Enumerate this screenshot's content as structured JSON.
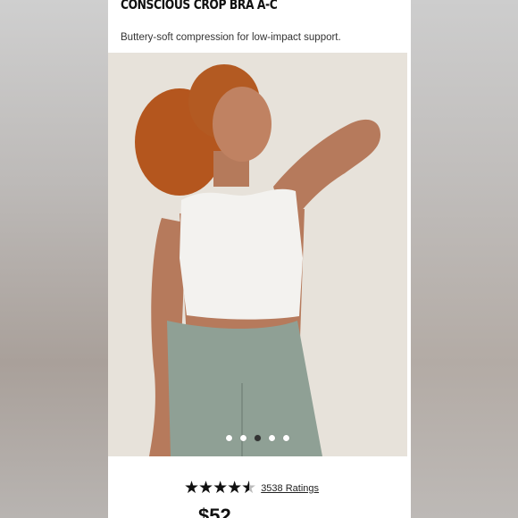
{
  "product": {
    "title": "CONSCIOUS CROP BRA A-C",
    "description": "Buttery-soft compression for low-impact support.",
    "rating_count_label": "3538 Ratings",
    "rating": 4.5,
    "price": "$52"
  },
  "carousel": {
    "count": 5,
    "active_index": 2
  },
  "colors": {
    "background": "#ffffff",
    "top": "#f2f1ee",
    "leggings": "#8fa095",
    "hair": "#b8571f"
  }
}
